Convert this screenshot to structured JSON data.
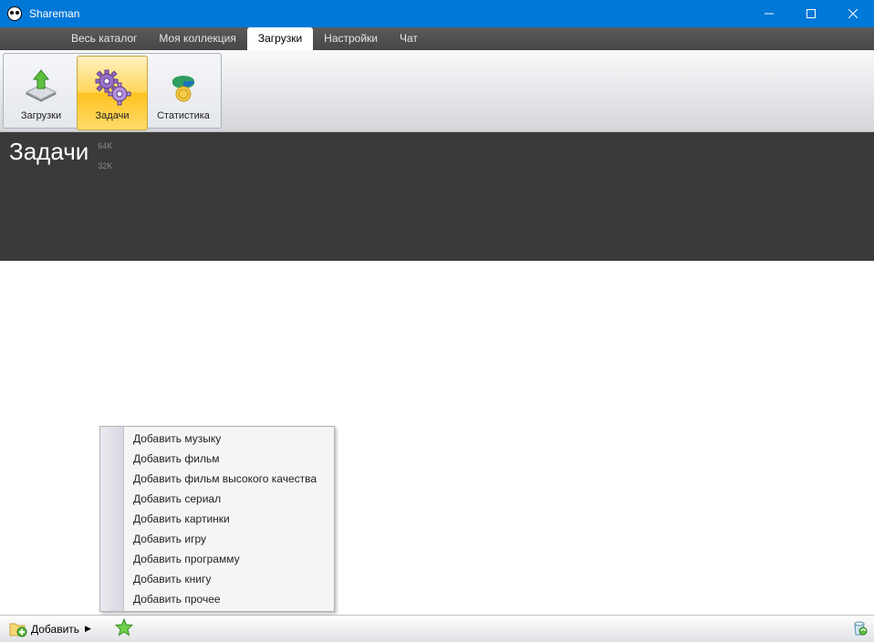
{
  "window": {
    "title": "Shareman"
  },
  "menu": {
    "tabs": [
      {
        "label": "Весь каталог",
        "active": false
      },
      {
        "label": "Моя коллекция",
        "active": false
      },
      {
        "label": "Загрузки",
        "active": true
      },
      {
        "label": "Настройки",
        "active": false
      },
      {
        "label": "Чат",
        "active": false
      }
    ]
  },
  "ribbon": {
    "buttons": [
      {
        "label": "Загрузки",
        "selected": false,
        "icon": "download"
      },
      {
        "label": "Задачи",
        "selected": true,
        "icon": "gears"
      },
      {
        "label": "Статистика",
        "selected": false,
        "icon": "stats"
      }
    ]
  },
  "header": {
    "title": "Задачи",
    "ticks": [
      "64K",
      "32K"
    ]
  },
  "context_menu": {
    "items": [
      "Добавить музыку",
      "Добавить фильм",
      "Добавить фильм высокого качества",
      "Добавить сериал",
      "Добавить картинки",
      "Добавить игру",
      "Добавить программу",
      "Добавить книгу",
      "Добавить прочее"
    ]
  },
  "statusbar": {
    "add_label": "Добавить"
  }
}
